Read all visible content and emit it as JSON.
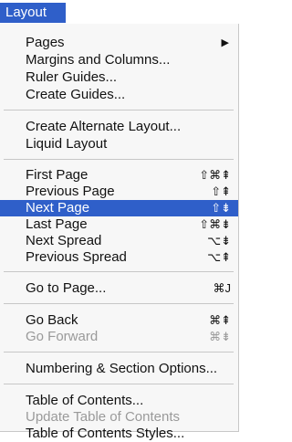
{
  "menu": {
    "title": "Layout",
    "items": [
      {
        "label": "Pages",
        "shortcut": "",
        "submenu": true
      },
      {
        "label": "Margins and Columns...",
        "shortcut": ""
      },
      {
        "label": "Ruler Guides...",
        "shortcut": ""
      },
      {
        "label": "Create Guides...",
        "shortcut": ""
      },
      {
        "label": "Create Alternate Layout...",
        "shortcut": ""
      },
      {
        "label": "Liquid Layout",
        "shortcut": ""
      },
      {
        "label": "First Page",
        "shortcut": "⇧⌘⇞"
      },
      {
        "label": "Previous Page",
        "shortcut": "⇧⇞"
      },
      {
        "label": "Next Page",
        "shortcut": "⇧⇟",
        "highlighted": true
      },
      {
        "label": "Last Page",
        "shortcut": "⇧⌘⇟"
      },
      {
        "label": "Next Spread",
        "shortcut": "⌥⇟"
      },
      {
        "label": "Previous Spread",
        "shortcut": "⌥⇞"
      },
      {
        "label": "Go to Page...",
        "shortcut": "⌘J"
      },
      {
        "label": "Go Back",
        "shortcut": "⌘⇞"
      },
      {
        "label": "Go Forward",
        "shortcut": "⌘⇟",
        "disabled": true
      },
      {
        "label": "Numbering & Section Options...",
        "shortcut": ""
      },
      {
        "label": "Table of Contents...",
        "shortcut": ""
      },
      {
        "label": "Update Table of Contents",
        "shortcut": "",
        "disabled": true
      },
      {
        "label": "Table of Contents Styles...",
        "shortcut": ""
      }
    ]
  },
  "colors": {
    "accent": "#2f5fc9",
    "menu_background": "#f7f7f7",
    "disabled_text": "#9a9a9a"
  },
  "icons": {
    "submenu": "submenu-arrow-icon"
  }
}
